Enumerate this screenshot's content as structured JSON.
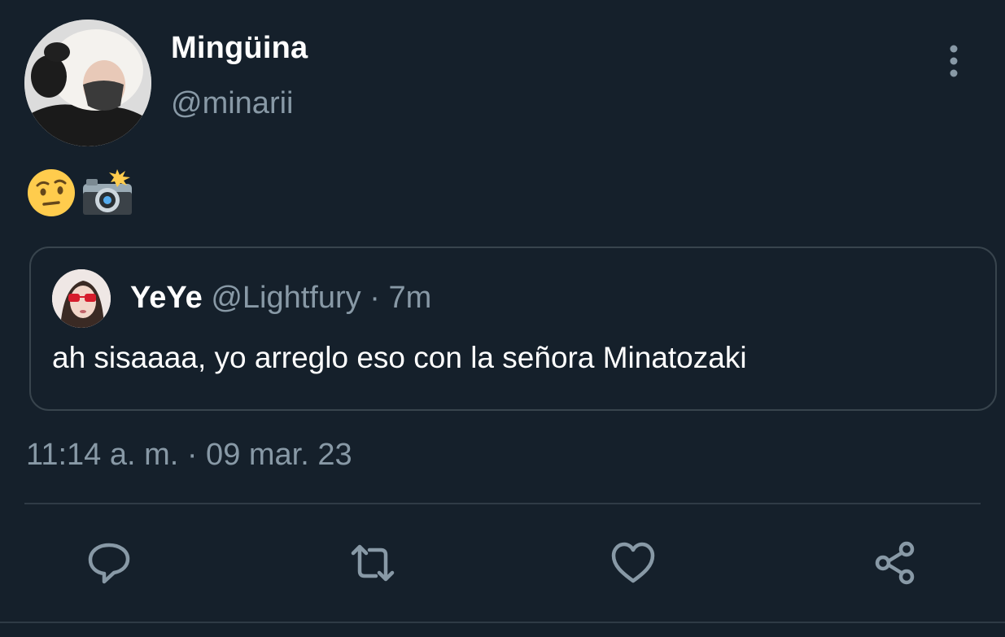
{
  "author": {
    "display_name": "Mingüina",
    "handle": "@minarii",
    "avatar_icon": "avatar-white-fur-hat"
  },
  "tweet": {
    "emojis": [
      "face-with-raised-eyebrow",
      "camera-with-flash"
    ],
    "timestamp": "11:14 a. m. · 09 mar. 23"
  },
  "quoted_tweet": {
    "display_name": "YeYe",
    "handle": "@Lightfury",
    "separator": "·",
    "time": "7m",
    "text": "ah sisaaaa, yo arreglo eso con la señora Minatozaki",
    "avatar_icon": "avatar-red-sunglasses"
  },
  "actions": {
    "reply_icon": "reply-icon",
    "retweet_icon": "retweet-icon",
    "like_icon": "heart-icon",
    "share_icon": "share-icon"
  },
  "colors": {
    "background": "#15202b",
    "secondary_text": "#8899a6",
    "border": "#38444d"
  }
}
